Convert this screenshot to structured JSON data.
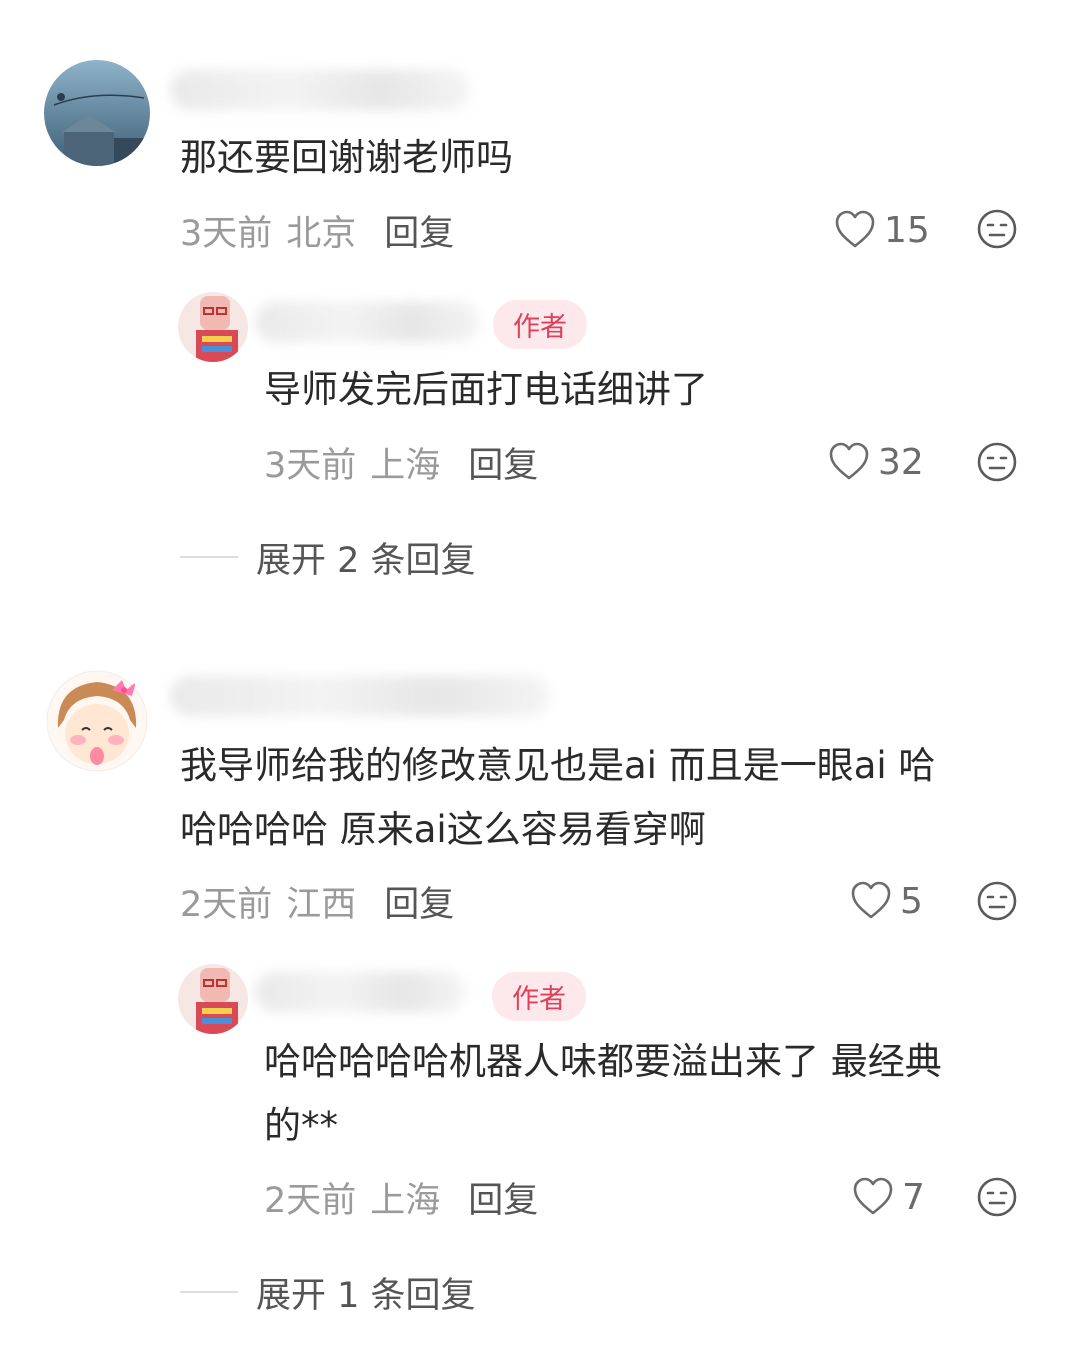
{
  "comments": [
    {
      "content": "那还要回谢谢老师吗",
      "time": "3天前",
      "location": "北京",
      "reply_label": "回复",
      "likes": "15",
      "reply": {
        "badge": "作者",
        "content": "导师发完后面打电话细讲了",
        "time": "3天前",
        "location": "上海",
        "reply_label": "回复",
        "likes": "32"
      },
      "expand_label": "展开 2 条回复"
    },
    {
      "content_line1": "我导师给我的修改意见也是ai 而且是一眼ai 哈",
      "content_line2": "哈哈哈哈 原来ai这么容易看穿啊",
      "time": "2天前",
      "location": "江西",
      "reply_label": "回复",
      "likes": "5",
      "reply": {
        "badge": "作者",
        "content_line1": "哈哈哈哈哈机器人味都要溢出来了 最经典",
        "content_line2": "的**",
        "time": "2天前",
        "location": "上海",
        "reply_label": "回复",
        "likes": "7"
      },
      "expand_label": "展开 1 条回复"
    }
  ],
  "icons": {
    "like": "heart-outline-icon",
    "emoji": "emoji-face-icon"
  },
  "colors": {
    "author_badge_text": "#e0405a",
    "author_badge_bg": "#fde9ec",
    "meta_text": "#9a9a9a"
  }
}
